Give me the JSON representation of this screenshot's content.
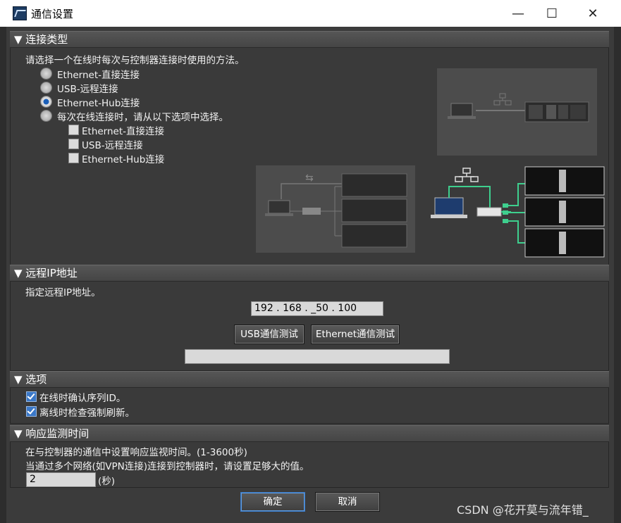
{
  "window": {
    "title": "通信设置",
    "minimize": "—",
    "maximize": "☐",
    "close": "✕"
  },
  "connection_type": {
    "header": "▼ 连接类型",
    "prompt": "请选择一个在线时每次与控制器连接时使用的方法。",
    "options": [
      {
        "label": "Ethernet-直接连接",
        "selected": false
      },
      {
        "label": "USB-远程连接",
        "selected": false
      },
      {
        "label": "Ethernet-Hub连接",
        "selected": true
      },
      {
        "label": "每次在线连接时，请从以下选项中选择。",
        "selected": false
      }
    ],
    "sub_options": [
      {
        "label": "Ethernet-直接连接",
        "checked": false
      },
      {
        "label": "USB-远程连接",
        "checked": false
      },
      {
        "label": "Ethernet-Hub连接",
        "checked": false
      }
    ]
  },
  "remote_ip": {
    "header": "▼ 远程IP地址",
    "prompt": "指定远程IP地址。",
    "ip_value": "192 . 168 . _50 . 100",
    "usb_test_label": "USB通信测试",
    "ethernet_test_label": "Ethernet通信测试",
    "result_value": ""
  },
  "options": {
    "header": "▼ 选项",
    "items": [
      {
        "label": "在线时确认序列ID。",
        "checked": true
      },
      {
        "label": "离线时检查强制刷新。",
        "checked": true
      }
    ]
  },
  "response_time": {
    "header": "▼ 响应监测时间",
    "line1": "在与控制器的通信中设置响应监视时间。(1-3600秒)",
    "line2": "当通过多个网络(如VPN连接)连接到控制器时，请设置足够大的值。",
    "value": "2",
    "unit": "(秒)"
  },
  "footer": {
    "ok_label": "确定",
    "cancel_label": "取消",
    "watermark": "CSDN @花开莫与流年错_"
  },
  "colors": {
    "accent": "#1b5fb8",
    "link_green": "#3ecf8e"
  }
}
